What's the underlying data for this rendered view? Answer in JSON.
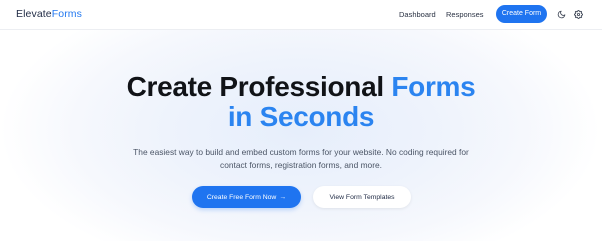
{
  "nav": {
    "brand_primary": "Elevate",
    "brand_accent": "Forms",
    "links": [
      "Dashboard",
      "Responses"
    ],
    "create_label": "Create Form",
    "theme_icon": "moon-icon",
    "settings_icon": "gear-icon"
  },
  "hero": {
    "title_line1_dark": "Create Professional ",
    "title_line1_blue": "Forms",
    "title_line2_blue": "in Seconds",
    "subtitle": "The easiest way to build and embed custom forms for your website. No coding required for contact forms, registration forms, and more.",
    "primary_cta": "Create Free Form Now",
    "primary_cta_icon": "→",
    "secondary_cta": "View Form Templates"
  },
  "colors": {
    "accent": "#1f74f0",
    "title_blue": "#2b84f0",
    "title_dark": "#111317",
    "subtitle": "#4b5566"
  }
}
